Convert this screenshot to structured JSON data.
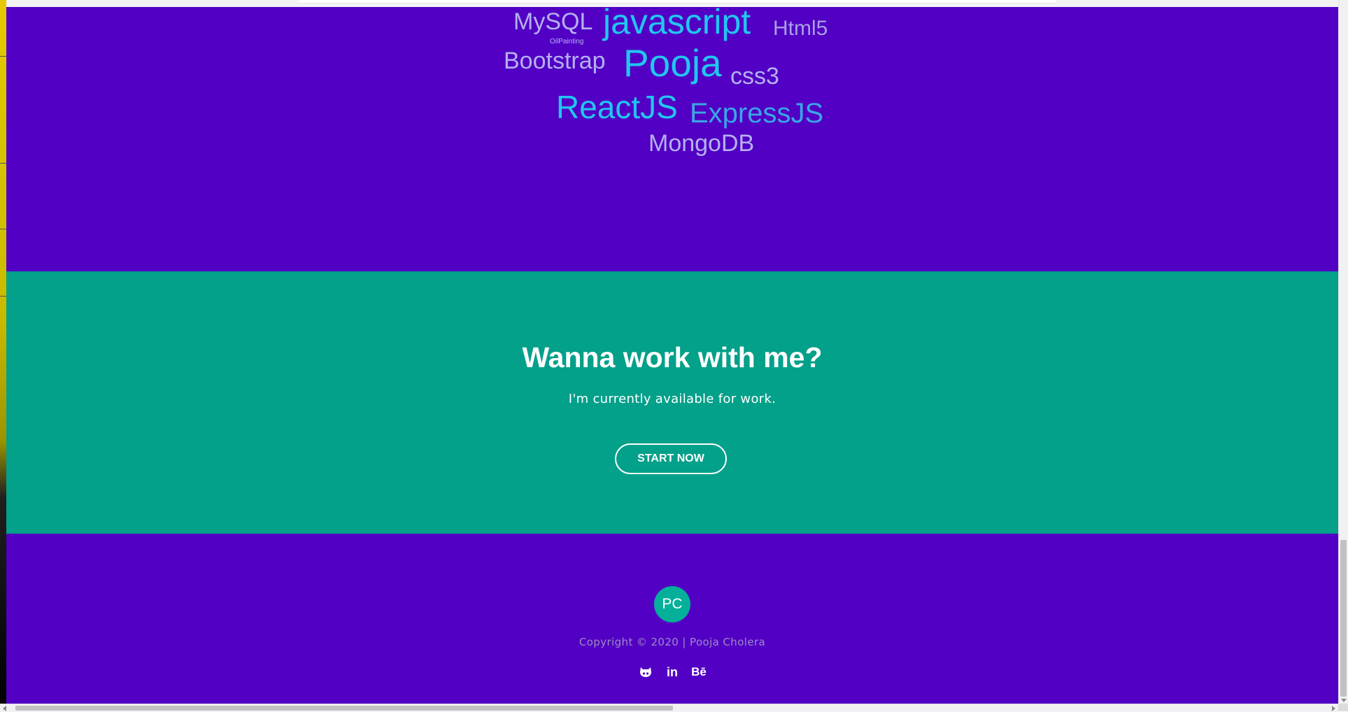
{
  "word_cloud": {
    "words": [
      {
        "text": "MySQL",
        "color": "#b5b0f0"
      },
      {
        "text": "javascript",
        "color": "#22c6f0"
      },
      {
        "text": "Html5",
        "color": "#a89fe6"
      },
      {
        "text": "OilPainting",
        "color": "#b5b0f0"
      },
      {
        "text": "Bootstrap",
        "color": "#b5b0f0"
      },
      {
        "text": "Pooja",
        "color": "#22c6f0"
      },
      {
        "text": "css3",
        "color": "#b5b0f0"
      },
      {
        "text": "ReactJS",
        "color": "#22c6f0"
      },
      {
        "text": "ExpressJS",
        "color": "#3aa6e6"
      },
      {
        "text": "MongoDB",
        "color": "#b5b0f0"
      }
    ]
  },
  "cta": {
    "title": "Wanna work with me?",
    "subtitle": "I'm currently available for work.",
    "button_label": "START NOW"
  },
  "footer": {
    "avatar_initials": "PC",
    "copyright": "Copyright © 2020 | Pooja Cholera",
    "socials": [
      {
        "icon": "github-icon"
      },
      {
        "icon": "linkedin-icon",
        "glyph": "in"
      },
      {
        "icon": "behance-icon",
        "glyph": "Bē"
      }
    ]
  },
  "colors": {
    "cloud_bg": "#5100c4",
    "cta_bg": "#03a08a",
    "footer_bg": "#5200c4",
    "avatar_bg": "#04b09a"
  }
}
